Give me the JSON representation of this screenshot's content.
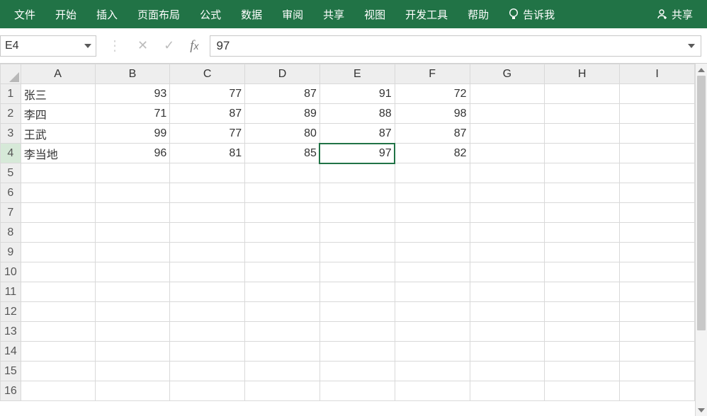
{
  "ribbon": {
    "items": [
      {
        "label": "文件"
      },
      {
        "label": "开始"
      },
      {
        "label": "插入"
      },
      {
        "label": "页面布局"
      },
      {
        "label": "公式"
      },
      {
        "label": "数据"
      },
      {
        "label": "审阅"
      },
      {
        "label": "共享"
      },
      {
        "label": "视图"
      },
      {
        "label": "开发工具"
      },
      {
        "label": "帮助"
      }
    ],
    "tell_me": "告诉我",
    "share": "共享"
  },
  "formula_bar": {
    "namebox": "E4",
    "value": "97"
  },
  "columns": [
    "A",
    "B",
    "C",
    "D",
    "E",
    "F",
    "G",
    "H",
    "I"
  ],
  "row_count": 16,
  "active": {
    "col": "E",
    "row": 4
  },
  "cells": {
    "1": {
      "A": "张三",
      "B": 93,
      "C": 77,
      "D": 87,
      "E": 91,
      "F": 72
    },
    "2": {
      "A": "李四",
      "B": 71,
      "C": 87,
      "D": 89,
      "E": 88,
      "F": 98
    },
    "3": {
      "A": "王武",
      "B": 99,
      "C": 77,
      "D": 80,
      "E": 87,
      "F": 87
    },
    "4": {
      "A": "李当地",
      "B": 96,
      "C": 81,
      "D": 85,
      "E": 97,
      "F": 82
    }
  }
}
